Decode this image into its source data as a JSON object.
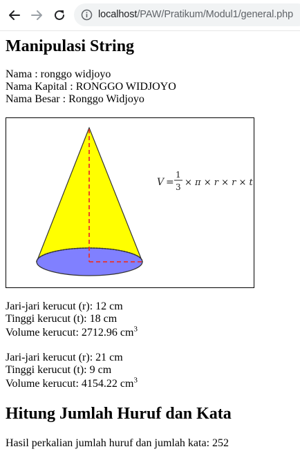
{
  "browser": {
    "url_host": "localhost",
    "url_path": "/PAW/Pratikum/Modul1/general.php"
  },
  "section1": {
    "title": "Manipulasi String",
    "nama": "Nama : ronggo widjoyo",
    "nama_kapital": "Nama Kapital : RONGGO WIDJOYO",
    "nama_besar": "Nama Besar : Ronggo Widjoyo"
  },
  "figure": {
    "formula_V": "V",
    "formula_eq": "=",
    "formula_num": "1",
    "formula_den": "3",
    "formula_rest": "× π × r × r × t",
    "colors": {
      "cone": "#ffff00",
      "base": "#8080ff",
      "height_line": "#e8322b"
    }
  },
  "kerucut1": {
    "jari": "Jari-jari kerucut (r): 12 cm",
    "tinggi": "Tinggi kerucut (t): 18 cm",
    "volume": "Volume kerucut: 2712.96 cm",
    "unit_sup": "3"
  },
  "kerucut2": {
    "jari": "Jari-jari kerucut (r): 21 cm",
    "tinggi": "Tinggi kerucut (t): 9 cm",
    "volume": "Volume kerucut: 4154.22 cm",
    "unit_sup": "3"
  },
  "section2": {
    "title": "Hitung Jumlah Huruf dan Kata",
    "hasil": "Hasil perkalian jumlah huruf dan jumlah kata: 252"
  }
}
